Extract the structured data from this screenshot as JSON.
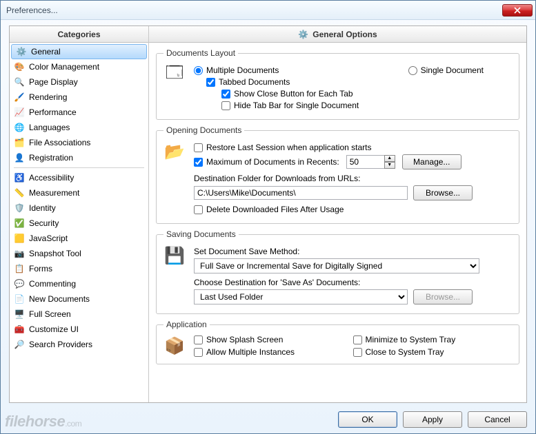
{
  "window": {
    "title": "Preferences..."
  },
  "sidebar": {
    "header": "Categories",
    "group1": [
      {
        "label": "General",
        "icon": "⚙️"
      },
      {
        "label": "Color Management",
        "icon": "🎨"
      },
      {
        "label": "Page Display",
        "icon": "🔍"
      },
      {
        "label": "Rendering",
        "icon": "🖌️"
      },
      {
        "label": "Performance",
        "icon": "📈"
      },
      {
        "label": "Languages",
        "icon": "🌐"
      },
      {
        "label": "File Associations",
        "icon": "🗂️"
      },
      {
        "label": "Registration",
        "icon": "👤"
      }
    ],
    "group2": [
      {
        "label": "Accessibility",
        "icon": "♿"
      },
      {
        "label": "Measurement",
        "icon": "📏"
      },
      {
        "label": "Identity",
        "icon": "🛡️"
      },
      {
        "label": "Security",
        "icon": "✅"
      },
      {
        "label": "JavaScript",
        "icon": "🟨"
      },
      {
        "label": "Snapshot Tool",
        "icon": "📷"
      },
      {
        "label": "Forms",
        "icon": "📋"
      },
      {
        "label": "Commenting",
        "icon": "💬"
      },
      {
        "label": "New Documents",
        "icon": "📄"
      },
      {
        "label": "Full Screen",
        "icon": "🖥️"
      },
      {
        "label": "Customize UI",
        "icon": "🧰"
      },
      {
        "label": "Search Providers",
        "icon": "🔎"
      }
    ],
    "selected": "General"
  },
  "main": {
    "header": "General Options",
    "docLayout": {
      "legend": "Documents Layout",
      "multiple": "Multiple Documents",
      "single": "Single Document",
      "tabbed": "Tabbed Documents",
      "showClose": "Show Close Button for Each Tab",
      "hideBar": "Hide Tab Bar for Single Document"
    },
    "opening": {
      "legend": "Opening Documents",
      "restore": "Restore Last Session when application starts",
      "maxRecent": "Maximum of Documents in Recents:",
      "maxRecentVal": "50",
      "manage": "Manage...",
      "destLabel": "Destination Folder for Downloads from URLs:",
      "destPath": "C:\\Users\\Mike\\Documents\\",
      "browse": "Browse...",
      "deleteDl": "Delete Downloaded Files After Usage"
    },
    "saving": {
      "legend": "Saving Documents",
      "setMethod": "Set Document Save Method:",
      "methodVal": "Full Save or Incremental Save for Digitally Signed",
      "chooseDest": "Choose Destination for 'Save As' Documents:",
      "destVal": "Last Used Folder",
      "browse": "Browse..."
    },
    "app": {
      "legend": "Application",
      "splash": "Show Splash Screen",
      "multi": "Allow Multiple Instances",
      "minTray": "Minimize to System Tray",
      "closeTray": "Close to System Tray"
    }
  },
  "buttons": {
    "ok": "OK",
    "apply": "Apply",
    "cancel": "Cancel"
  },
  "watermark": {
    "main": "filehorse",
    "suffix": ".com"
  }
}
